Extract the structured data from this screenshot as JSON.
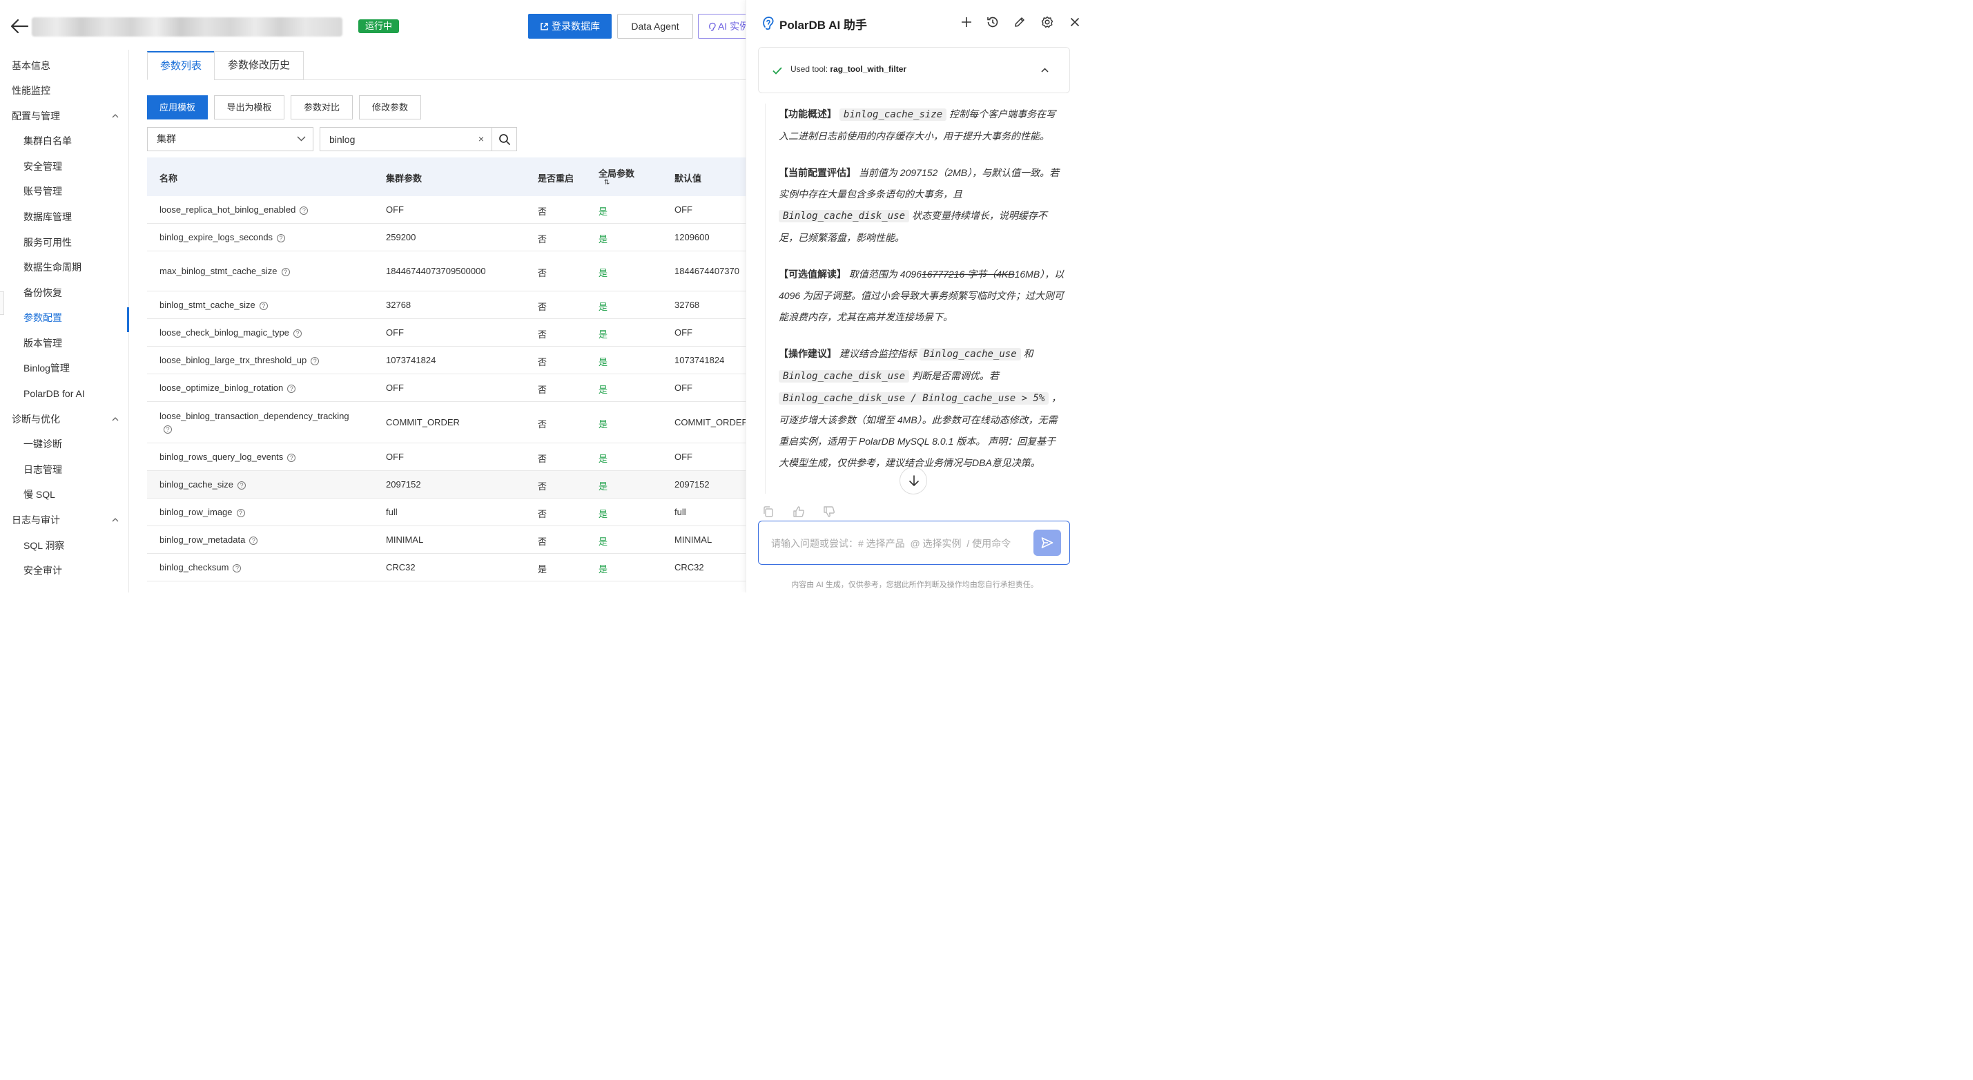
{
  "header": {
    "status": "运行中",
    "login_db": "登录数据库",
    "data_agent": "Data Agent",
    "ai_instance": "AI 实例"
  },
  "sidebar": {
    "items": [
      {
        "label": "基本信息",
        "level": 1
      },
      {
        "label": "性能监控",
        "level": 1
      },
      {
        "label": "配置与管理",
        "level": 1,
        "expanded": true
      },
      {
        "label": "集群白名单",
        "level": 2
      },
      {
        "label": "安全管理",
        "level": 2
      },
      {
        "label": "账号管理",
        "level": 2
      },
      {
        "label": "数据库管理",
        "level": 2
      },
      {
        "label": "服务可用性",
        "level": 2
      },
      {
        "label": "数据生命周期",
        "level": 2
      },
      {
        "label": "备份恢复",
        "level": 2
      },
      {
        "label": "参数配置",
        "level": 2,
        "active": true
      },
      {
        "label": "版本管理",
        "level": 2
      },
      {
        "label": "Binlog管理",
        "level": 2
      },
      {
        "label": "PolarDB for AI",
        "level": 2
      },
      {
        "label": "诊断与优化",
        "level": 1,
        "expanded": true
      },
      {
        "label": "一键诊断",
        "level": 2
      },
      {
        "label": "日志管理",
        "level": 2
      },
      {
        "label": "慢 SQL",
        "level": 2
      },
      {
        "label": "日志与审计",
        "level": 1,
        "expanded": true
      },
      {
        "label": "SQL 洞察",
        "level": 2
      },
      {
        "label": "安全审计",
        "level": 2
      }
    ]
  },
  "tabs": [
    {
      "label": "参数列表",
      "active": true
    },
    {
      "label": "参数修改历史",
      "active": false
    }
  ],
  "actions": {
    "apply_template": "应用模板",
    "export_template": "导出为模板",
    "compare": "参数对比",
    "modify": "修改参数"
  },
  "filter": {
    "scope_value": "集群",
    "search_value": "binlog",
    "clear": "×"
  },
  "table": {
    "headers": {
      "name": "名称",
      "cluster_param": "集群参数",
      "restart": "是否重启",
      "global": "全局参数",
      "sort_glyph": "⇅",
      "default": "默认值"
    },
    "rows": [
      {
        "name": "loose_replica_hot_binlog_enabled",
        "value": "OFF",
        "restart": "否",
        "global": "是",
        "default": "OFF"
      },
      {
        "name": "binlog_expire_logs_seconds",
        "value": "259200",
        "restart": "否",
        "global": "是",
        "default": "1209600"
      },
      {
        "name": "max_binlog_stmt_cache_size",
        "value": "18446744073709500000",
        "restart": "否",
        "global": "是",
        "default": "1844674407370"
      },
      {
        "name": "binlog_stmt_cache_size",
        "value": "32768",
        "restart": "否",
        "global": "是",
        "default": "32768"
      },
      {
        "name": "loose_check_binlog_magic_type",
        "value": "OFF",
        "restart": "否",
        "global": "是",
        "default": "OFF"
      },
      {
        "name": "loose_binlog_large_trx_threshold_up",
        "value": "1073741824",
        "restart": "否",
        "global": "是",
        "default": "1073741824"
      },
      {
        "name": "loose_optimize_binlog_rotation",
        "value": "OFF",
        "restart": "否",
        "global": "是",
        "default": "OFF"
      },
      {
        "name": "loose_binlog_transaction_dependency_tracking",
        "value": "COMMIT_ORDER",
        "restart": "否",
        "global": "是",
        "default": "COMMIT_ORDEF"
      },
      {
        "name": "binlog_rows_query_log_events",
        "value": "OFF",
        "restart": "否",
        "global": "是",
        "default": "OFF"
      },
      {
        "name": "binlog_cache_size",
        "value": "2097152",
        "restart": "否",
        "global": "是",
        "default": "2097152"
      },
      {
        "name": "binlog_row_image",
        "value": "full",
        "restart": "否",
        "global": "是",
        "default": "full"
      },
      {
        "name": "binlog_row_metadata",
        "value": "MINIMAL",
        "restart": "否",
        "global": "是",
        "default": "MINIMAL"
      },
      {
        "name": "binlog_checksum",
        "value": "CRC32",
        "restart": "是",
        "global": "是",
        "default": "CRC32"
      }
    ]
  },
  "assistant": {
    "title": "PolarDB AI 助手",
    "tool_prefix": "Used tool: ",
    "tool_name": "rag_tool_with_filter",
    "p1": {
      "head": "【功能概述】",
      "code": "binlog_cache_size",
      "text": " 控制每个客户端事务在写入二进制日志前使用的内存缓存大小，用于提升大事务的性能。"
    },
    "p2": {
      "head": "【当前配置评估】",
      "text1": " 当前值为 2097152（2MB），与默认值一致。若实例中存在大量包含多条语句的大事务，且 ",
      "code": "Binlog_cache_disk_use",
      "text2": " 状态变量持续增长，说明缓存不足，已频繁落盘，影响性能。"
    },
    "p3": {
      "head": "【可选值解读】",
      "text1": " 取值范围为 4096",
      "strike": "16777216 字节（4KB",
      "text2": "16MB），以 4096 为因子调整。值过小会导致大事务频繁写临时文件；过大则可能浪费内存，尤其在高并发连接场景下。"
    },
    "p4": {
      "head": "【操作建议】",
      "text1": " 建议结合监控指标 ",
      "code1": "Binlog_cache_use",
      "text2": " 和 ",
      "code2": "Binlog_cache_disk_use",
      "text3": " 判断是否需调优。若 ",
      "code3": "Binlog_cache_disk_use / Binlog_cache_use > 5%",
      "text4": " ，可逐步增大该参数（如增至 4MB）。此参数可在线动态修改，无需重启实例，适用于 PolarDB MySQL 8.0.1 版本。 声明：回复基于大模型生成，仅供参考，建议结合业务情况与DBA意见决策。"
    },
    "input_placeholder": "请输入问题或尝试：# 选择产品  @ 选择实例  / 使用命令",
    "disclaimer": "内容由 AI 生成，仅供参考，您据此所作判断及操作均由您自行承担责任。"
  },
  "colors": {
    "primary": "#1a6fd8",
    "success": "#1fa14a",
    "ai_accent": "#6b5fe0",
    "send": "#8ea8ee"
  }
}
